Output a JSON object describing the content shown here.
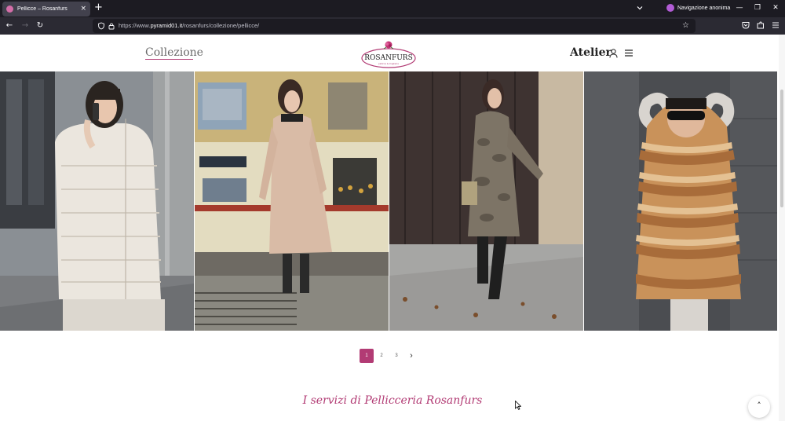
{
  "browser": {
    "tab_title": "Pellicce – Rosanfurs",
    "tab_close": "×",
    "new_tab": "+",
    "private_label": "Navigazione anonima",
    "url_prefix": "https://www.",
    "url_domain": "pyramid01.it",
    "url_path": "/rosanfurs/collezione/pellicce/"
  },
  "header": {
    "collection_link": "Collezione",
    "logo_text": "ROSANFURS",
    "logo_tagline": "pellicce & maglieria",
    "atelier_link": "Atelier"
  },
  "pagination": {
    "pages": [
      "1",
      "2",
      "3"
    ],
    "active": "1",
    "next": "›"
  },
  "services_title": "I servizi di Pellicceria Rosanfurs",
  "back_to_top": "˄",
  "colors": {
    "accent": "#b23b74",
    "chrome_dark": "#1c1b22",
    "chrome_mid": "#2b2a33"
  }
}
